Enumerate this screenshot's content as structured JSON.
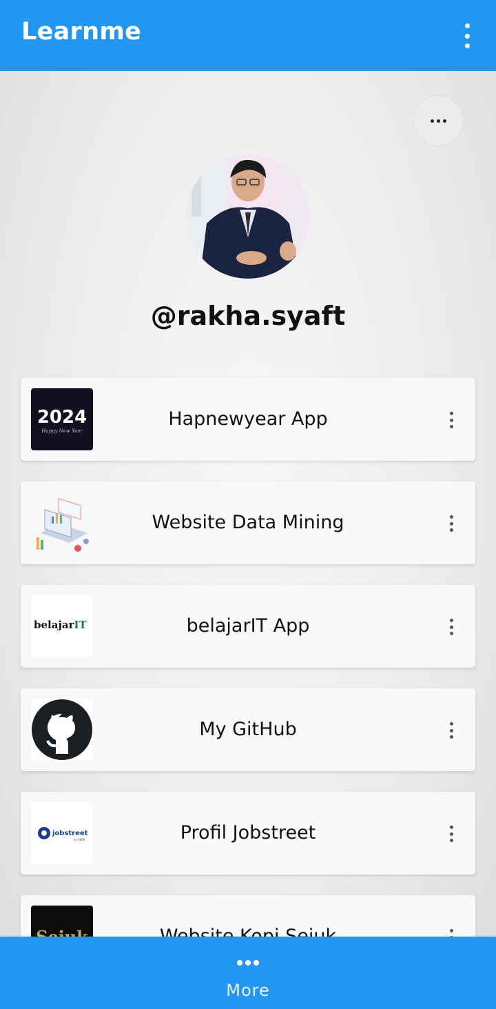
{
  "app": {
    "title": "Learnme"
  },
  "profile": {
    "username": "@rakha.syaft"
  },
  "links": [
    {
      "label": "Hapnewyear App",
      "thumb_text": "2024",
      "thumb_subtext": "Happy New Year"
    },
    {
      "label": "Website Data Mining"
    },
    {
      "label": "belajarIT App",
      "thumb_text": "belajar",
      "thumb_text_accent": "IT"
    },
    {
      "label": "My GitHub"
    },
    {
      "label": "Profil Jobstreet",
      "thumb_text": "jobstreet",
      "thumb_subtext": "by SEEK"
    },
    {
      "label": "Website Kopi Sejuk",
      "thumb_text": "Sejuk"
    }
  ],
  "bottom": {
    "more_label": "More"
  },
  "colors": {
    "primary": "#2196f3",
    "accent_green": "#1b7a2e"
  }
}
